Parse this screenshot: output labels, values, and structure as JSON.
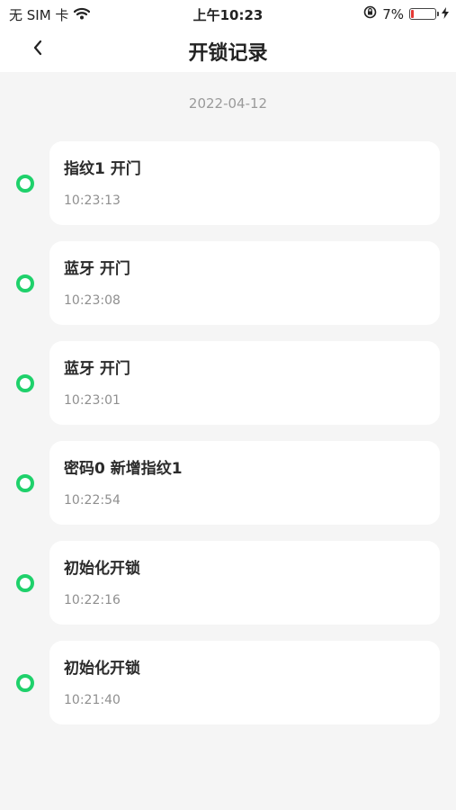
{
  "status_bar": {
    "carrier": "无 SIM 卡",
    "time": "上午10:23",
    "battery_percent": "7%"
  },
  "nav": {
    "title": "开锁记录",
    "back_icon": "chevron-left-icon"
  },
  "date": "2022-04-12",
  "records": [
    {
      "title": "指纹1 开门",
      "time": "10:23:13"
    },
    {
      "title": "蓝牙 开门",
      "time": "10:23:08"
    },
    {
      "title": "蓝牙 开门",
      "time": "10:23:01"
    },
    {
      "title": "密码0 新增指纹1",
      "time": "10:22:54"
    },
    {
      "title": " 初始化开锁",
      "time": "10:22:16"
    },
    {
      "title": " 初始化开锁",
      "time": "10:21:40"
    }
  ],
  "colors": {
    "accent": "#1fd16b",
    "background": "#f5f5f5",
    "card": "#ffffff",
    "battery_low": "#e53935"
  }
}
